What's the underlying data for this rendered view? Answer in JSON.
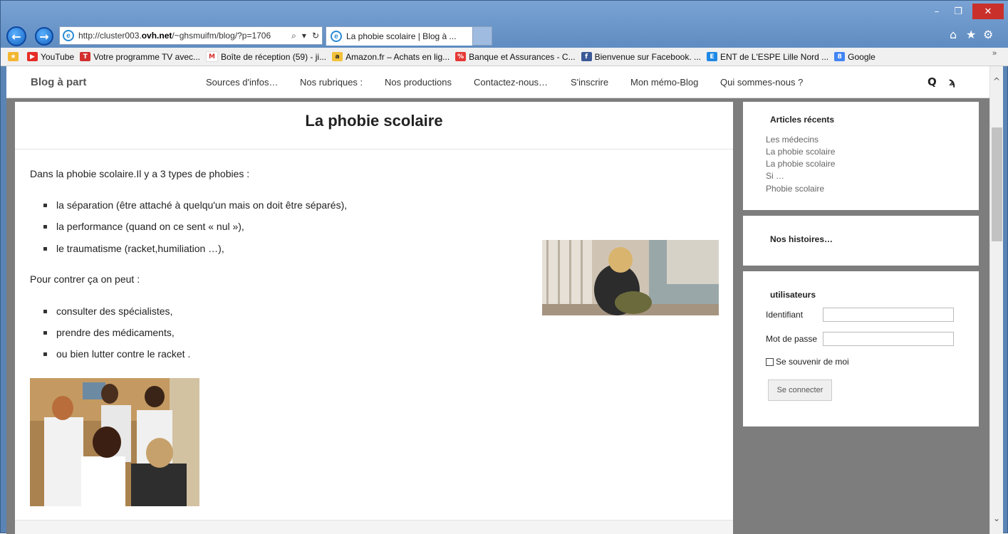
{
  "browser": {
    "address": {
      "url_prefix": "http://cluster003.",
      "url_domain": "ovh.net",
      "url_suffix": "/~ghsmuifm/blog/?p=1706",
      "search_icon": "search-icon",
      "dropdown": "▾",
      "refresh_icon": "↻"
    },
    "tab": {
      "title": "La phobie scolaire | Blog à ...",
      "close": "×"
    },
    "window_controls": {
      "minimize": "–",
      "maximize": "❐",
      "close": "✕"
    },
    "right_icons": {
      "home": "⌂",
      "favorites": "★",
      "settings": "⚙"
    }
  },
  "favorites": [
    {
      "label": "YouTube",
      "icon": "youtube-icon",
      "color": "#e52d27",
      "glyph": "▶"
    },
    {
      "label": "Votre programme TV avec...",
      "icon": "tv-icon",
      "color": "#d32f2f",
      "glyph": "T"
    },
    {
      "label": "Boîte de réception (59) - ji...",
      "icon": "gmail-icon",
      "color": "#ffffff",
      "glyph": "M"
    },
    {
      "label": "Amazon.fr – Achats en lig...",
      "icon": "amazon-icon",
      "color": "#f3c13a",
      "glyph": "a"
    },
    {
      "label": "Banque et Assurances - C...",
      "icon": "bank-icon",
      "color": "#e53935",
      "glyph": "%"
    },
    {
      "label": "Bienvenue sur Facebook. ...",
      "icon": "facebook-icon",
      "color": "#3b5998",
      "glyph": "f"
    },
    {
      "label": "ENT de L'ESPE Lille Nord ...",
      "icon": "ent-icon",
      "color": "#1e88e5",
      "glyph": "E"
    },
    {
      "label": "Google",
      "icon": "google-icon",
      "color": "#4285f4",
      "glyph": "8"
    }
  ],
  "favorites_more": "»",
  "site": {
    "brand": "Blog à part",
    "nav": [
      "Sources d'infos…",
      "Nos rubriques :",
      "Nos productions",
      "Contactez-nous…",
      "S'inscrire",
      "Mon mémo-Blog",
      "Qui sommes-nous ?"
    ],
    "search_glyph": "Q",
    "rss_glyph": "ϡ"
  },
  "article": {
    "title": "La phobie scolaire",
    "intro": "Dans la phobie scolaire.Il y a 3 types de phobies :",
    "types": [
      "la séparation (être attaché à quelqu'un mais on doit être séparés),",
      "la performance (quand on ce sent « nul »),",
      "le traumatisme (racket,humiliation …),"
    ],
    "counter_intro": "Pour contrer ça on peut :",
    "remedies": [
      "consulter des spécialistes,",
      "prendre des médicaments,",
      "ou bien lutter contre le racket ."
    ]
  },
  "sidebar": {
    "recent": {
      "title": "Articles récents",
      "items": [
        "Les médecins",
        "La phobie scolaire",
        "La phobie scolaire",
        "Si …",
        "Phobie scolaire"
      ]
    },
    "stories": {
      "title": "Nos histoires…"
    },
    "login": {
      "title": "utilisateurs",
      "username_label": "Identifiant",
      "password_label": "Mot de passe",
      "remember_label": "Se souvenir de moi",
      "submit_label": "Se connecter"
    }
  },
  "scrollbar": {
    "up": "^",
    "down": "⌄"
  }
}
